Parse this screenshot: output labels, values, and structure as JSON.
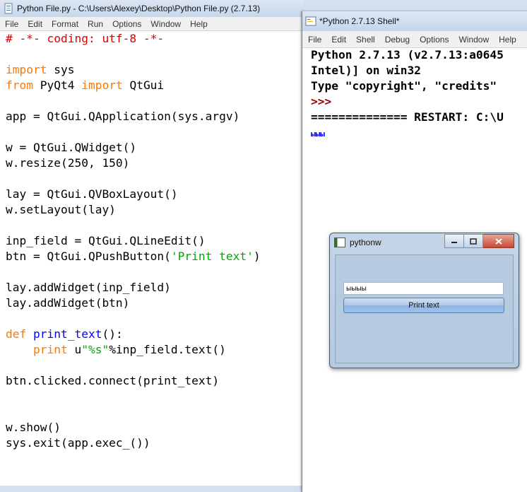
{
  "editor": {
    "title": "Python File.py - C:\\Users\\Alexey\\Desktop\\Python File.py (2.7.13)",
    "menu": [
      "File",
      "Edit",
      "Format",
      "Run",
      "Options",
      "Window",
      "Help"
    ],
    "code_lines": [
      [
        {
          "t": "# -*- coding: utf-8 -*-",
          "c": "cm"
        }
      ],
      [],
      [
        {
          "t": "import",
          "c": "kw"
        },
        {
          "t": " sys"
        }
      ],
      [
        {
          "t": "from",
          "c": "kw"
        },
        {
          "t": " PyQt4 "
        },
        {
          "t": "import",
          "c": "kw"
        },
        {
          "t": " QtGui"
        }
      ],
      [],
      [
        {
          "t": "app = QtGui.QApplication(sys.argv)"
        }
      ],
      [],
      [
        {
          "t": "w = QtGui.QWidget()"
        }
      ],
      [
        {
          "t": "w.resize(250, 150)"
        }
      ],
      [],
      [
        {
          "t": "lay = QtGui.QVBoxLayout()"
        }
      ],
      [
        {
          "t": "w.setLayout(lay)"
        }
      ],
      [],
      [
        {
          "t": "inp_field = QtGui.QLineEdit()"
        }
      ],
      [
        {
          "t": "btn = QtGui.QPushButton("
        },
        {
          "t": "'Print text'",
          "c": "st"
        },
        {
          "t": ")"
        }
      ],
      [],
      [
        {
          "t": "lay.addWidget(inp_field)"
        }
      ],
      [
        {
          "t": "lay.addWidget(btn)"
        }
      ],
      [],
      [
        {
          "t": "def",
          "c": "kw"
        },
        {
          "t": " "
        },
        {
          "t": "print_text",
          "c": "df"
        },
        {
          "t": "():"
        }
      ],
      [
        {
          "t": "    "
        },
        {
          "t": "print",
          "c": "kw"
        },
        {
          "t": " u"
        },
        {
          "t": "\"%s\"",
          "c": "st"
        },
        {
          "t": "%inp_field.text()"
        }
      ],
      [],
      [
        {
          "t": "btn.clicked.connect(print_text)"
        }
      ],
      [],
      [],
      [
        {
          "t": "w.show()"
        }
      ],
      [
        {
          "t": "sys.exit(app.exec_())"
        }
      ]
    ]
  },
  "shell": {
    "title": "*Python 2.7.13 Shell*",
    "menu": [
      "File",
      "Edit",
      "Shell",
      "Debug",
      "Options",
      "Window",
      "Help"
    ],
    "lines": [
      [
        {
          "t": "Python 2.7.13 (v2.7.13:a0645"
        }
      ],
      [
        {
          "t": "Intel)] on win32"
        }
      ],
      [
        {
          "t": "Type \"copyright\", \"credits\""
        }
      ],
      [
        {
          "t": ">>>",
          "c": "prompt"
        }
      ],
      [
        {
          "t": "============== RESTART: C:\\U"
        }
      ],
      [
        {
          "t": "ыыы",
          "c": "out-small"
        }
      ]
    ]
  },
  "qt_window": {
    "title": "pythonw",
    "line_edit_value": "ыыыы",
    "button_label": "Print text"
  },
  "colors": {
    "keyword": "#ff7700",
    "comment": "#dd0000",
    "string": "#00aa00",
    "definition": "#0000ff",
    "prompt": "#990000",
    "stdout": "#0000ff"
  }
}
